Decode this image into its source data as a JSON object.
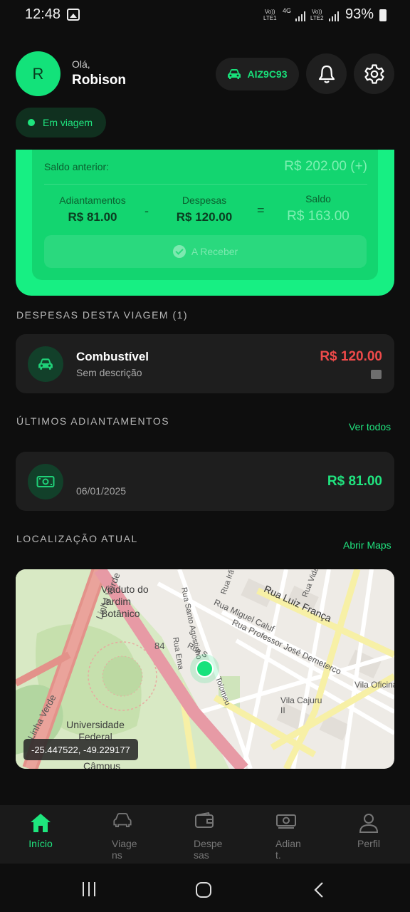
{
  "status_bar": {
    "time": "12:48",
    "sim1": "Vo))\nLTE1",
    "network": "4G",
    "sim2": "Vo))\nLTE2",
    "battery": "93%"
  },
  "header": {
    "avatar_initial": "R",
    "greeting": "Olá,",
    "user_name": "Robison",
    "plate": "AIZ9C93",
    "trip_status": "Em viagem"
  },
  "balance": {
    "previous_label": "Saldo anterior:",
    "previous_value": "R$ 202.00 (+)",
    "advances_label": "Adiantamentos",
    "advances_value": "R$ 81.00",
    "minus": "-",
    "expenses_label": "Despesas",
    "expenses_value": "R$ 120.00",
    "equals": "=",
    "balance_label": "Saldo",
    "balance_value": "R$ 163.00",
    "receive_label": "A Receber"
  },
  "expenses_section": {
    "title": "DESPESAS DESTA VIAGEM (1)",
    "items": [
      {
        "name": "Combustível",
        "description": "Sem descrição",
        "amount": "R$ 120.00"
      }
    ]
  },
  "advances_section": {
    "title": "ÚLTIMOS ADIANTAMENTOS",
    "link": "Ver todos",
    "items": [
      {
        "date": "06/01/2025",
        "amount": "R$ 81.00"
      }
    ]
  },
  "location_section": {
    "title": "LOCALIZAÇÃO ATUAL",
    "link": "Abrir Maps",
    "coordinates": "-25.447522, -49.229177",
    "map_labels": {
      "viaduto": "Viaduto do Jardim Botânico",
      "linha_verde_top": "Linha Verde",
      "linha_verde_bottom": "Linha Verde",
      "universidade": "Universidade Federal",
      "campus": "Câmpus",
      "route": "84",
      "luiz_franca": "Rua Luiz França",
      "miguel_caluf": "Rua Miguel Caluf",
      "jose_demeterco": "Rua Professor José Demeterco",
      "santo_agostinho": "Rua Santo Agostinho",
      "vila_oficinas": "Vila Oficinas",
      "vila_cajuru": "Vila Cajuru II",
      "rua_s": "Rua S",
      "rua_ira": "Rua Irã",
      "rua_vida": "Rua Vida",
      "rua_tolomeu": "Tolomeu",
      "rua_ema": "Rua Ema"
    }
  },
  "bottom_nav": {
    "items": [
      {
        "label": "Início",
        "active": true
      },
      {
        "label": "Viage\nns",
        "active": false
      },
      {
        "label": "Despe\nsas",
        "active": false
      },
      {
        "label": "Adian\nt.",
        "active": false
      },
      {
        "label": "Perfil",
        "active": false
      }
    ]
  },
  "colors": {
    "accent": "#17ef83",
    "background": "#0e0e0e",
    "card": "#1e1e1e",
    "expense_red": "#ef4a4a"
  }
}
